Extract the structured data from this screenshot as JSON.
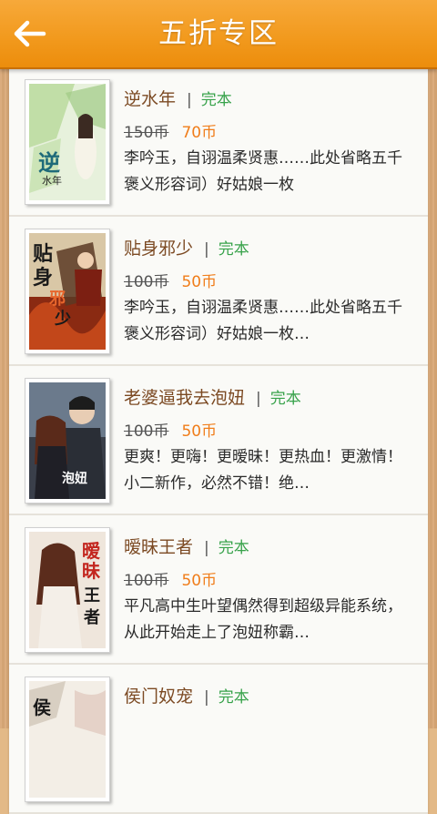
{
  "header": {
    "title": "五折专区",
    "back_icon": "arrow-left-icon"
  },
  "colors": {
    "header": "#f29a1e",
    "title_text": "#7c4a23",
    "status": "#37a24a",
    "discount_price": "#f07d1a"
  },
  "books": [
    {
      "title": "逆水年",
      "status": "完本",
      "original_price": "150币",
      "discount_price": "70币",
      "description": "李吟玉，自诩温柔贤惠……此处省略五千褒义形容词）好姑娘一枚"
    },
    {
      "title": "贴身邪少",
      "status": "完本",
      "original_price": "100币",
      "discount_price": "50币",
      "description": "李吟玉，自诩温柔贤惠……此处省略五千褒义形容词）好姑娘一枚…"
    },
    {
      "title": "老婆逼我去泡妞",
      "status": "完本",
      "original_price": "100币",
      "discount_price": "50币",
      "description": "更爽！更嗨！更暧昧！更热血！更激情！小二新作，必然不错！绝…"
    },
    {
      "title": "暧昧王者",
      "status": "完本",
      "original_price": "100币",
      "discount_price": "50币",
      "description": "平凡高中生叶望偶然得到超级异能系统，从此开始走上了泡妞称霸…"
    },
    {
      "title": "侯门奴宠",
      "status": "完本",
      "original_price": "",
      "discount_price": "",
      "description": ""
    }
  ]
}
